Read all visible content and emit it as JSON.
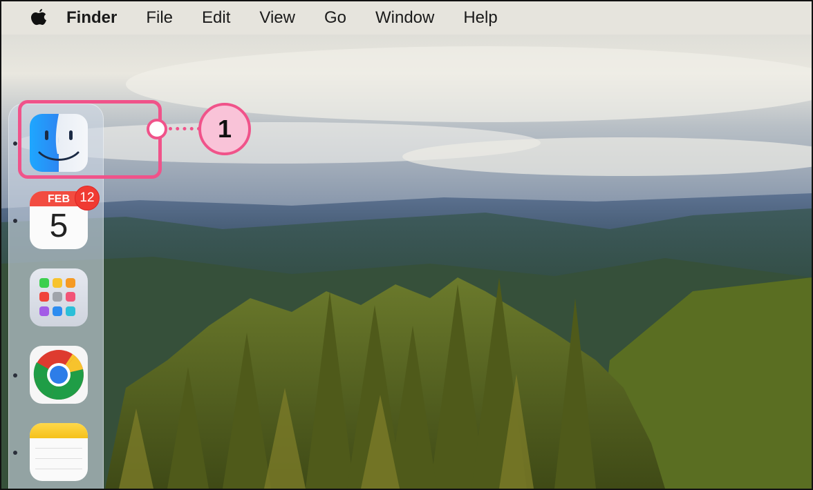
{
  "menubar": {
    "apple_icon": "apple-logo",
    "items": [
      "Finder",
      "File",
      "Edit",
      "View",
      "Go",
      "Window",
      "Help"
    ]
  },
  "dock": {
    "apps": [
      {
        "name": "Finder",
        "icon": "finder-icon",
        "running": true
      },
      {
        "name": "Calendar",
        "icon": "calendar-icon",
        "month": "FEB",
        "day": "5",
        "badge": "12",
        "running": true
      },
      {
        "name": "Launchpad",
        "icon": "launchpad-icon",
        "running": false
      },
      {
        "name": "Chrome",
        "icon": "chrome-icon",
        "running": true
      },
      {
        "name": "Notes",
        "icon": "notes-icon",
        "running": true
      }
    ]
  },
  "callout": {
    "number": "1",
    "color": "#f0538a",
    "fill": "#f9c3d8"
  },
  "colors": {
    "menubar_bg": "#e6e4dd",
    "badge_red": "#f03a32"
  }
}
